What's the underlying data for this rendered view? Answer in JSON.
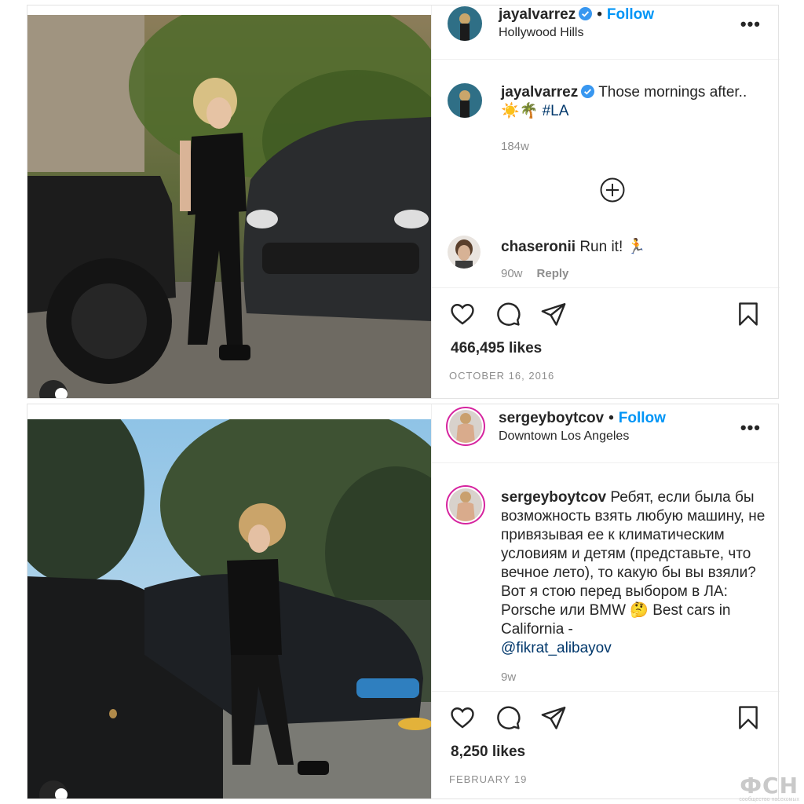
{
  "posts": [
    {
      "username": "jayalvarrez",
      "follow_label": "Follow",
      "location": "Hollywood Hills",
      "more_label": "•••",
      "caption_text": "Those mornings after..",
      "caption_emoji": "☀️🌴 ",
      "caption_hashtag": "#LA",
      "caption_time": "184w",
      "comment": {
        "username": "chaseronii",
        "text": "Run it! 🏃",
        "time": "90w",
        "reply_label": "Reply"
      },
      "likes": "466,495 likes",
      "date": "OCTOBER 16, 2016"
    },
    {
      "username": "sergeyboytcov",
      "follow_label": "Follow",
      "location": "Downtown Los Angeles",
      "more_label": "•••",
      "caption_text": "Ребят, если была бы возможность взять любую машину, не привязывая ее к климатическим условиям и детям (представьте, что вечное лето), то какую бы вы взяли? Вот я стою перед выбором в ЛА: Porsche или BMW 🤔 Best cars in California -",
      "caption_mention": "@fikrat_alibayov",
      "caption_time": "9w",
      "likes": "8,250 likes",
      "date": "FEBRUARY 19"
    }
  ],
  "icons": [
    "heart-icon",
    "comment-icon",
    "share-icon",
    "bookmark-icon",
    "plus-circle-icon",
    "verified-icon",
    "user-icon"
  ],
  "colors": {
    "follow": "#0095f6",
    "link": "#00376b",
    "muted": "#8e8e8e",
    "verified": "#3897f0",
    "story_ring": "#d6249f"
  },
  "watermark": {
    "logo": "ФСН",
    "tagline": "сообщество насекомых"
  }
}
